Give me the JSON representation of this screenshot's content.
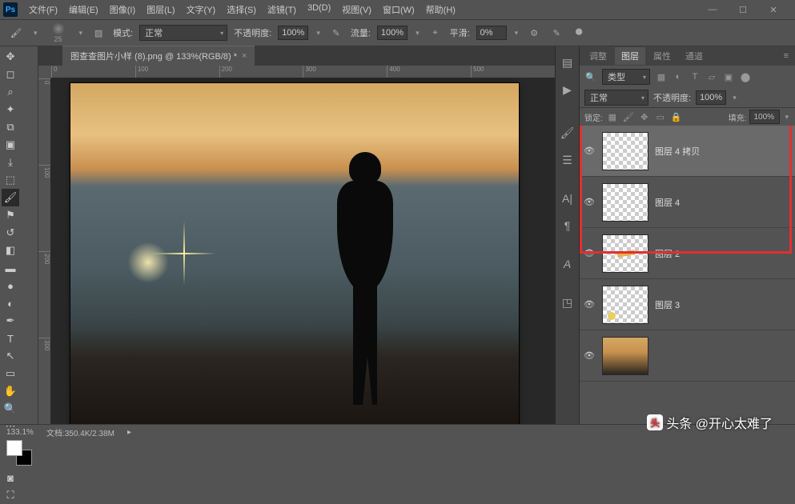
{
  "app": {
    "logo": "Ps"
  },
  "menu": [
    "文件(F)",
    "编辑(E)",
    "图像(I)",
    "图层(L)",
    "文字(Y)",
    "选择(S)",
    "滤镜(T)",
    "3D(D)",
    "视图(V)",
    "窗口(W)",
    "帮助(H)"
  ],
  "optbar": {
    "brush_size": "25",
    "mode_label": "模式:",
    "mode_value": "正常",
    "opacity_label": "不透明度:",
    "opacity_value": "100%",
    "flow_label": "流量:",
    "flow_value": "100%",
    "smooth_label": "平滑:",
    "smooth_value": "0%"
  },
  "document": {
    "tab_title": "图查查图片小样 (8).png @ 133%(RGB/8) *",
    "ruler_h": [
      "0",
      "100",
      "200",
      "300",
      "400",
      "500"
    ],
    "ruler_v": [
      "0",
      "100",
      "200",
      "300"
    ]
  },
  "panel_tabs": {
    "adjust": "调整",
    "layers": "图层",
    "props": "属性",
    "channels": "通道"
  },
  "layer_panel": {
    "filter_label": "类型",
    "blend_mode": "正常",
    "opacity_label": "不透明度:",
    "opacity_value": "100%",
    "lock_label": "锁定:",
    "fill_label": "填充:",
    "fill_value": "100%",
    "layers": [
      {
        "name": "图层 4 拷贝",
        "visible": true,
        "selected": true,
        "thumb": "checker"
      },
      {
        "name": "图层 4",
        "visible": true,
        "selected": false,
        "thumb": "checker"
      },
      {
        "name": "图层 2",
        "visible": true,
        "selected": false,
        "thumb": "smear"
      },
      {
        "name": "图层 3",
        "visible": true,
        "selected": false,
        "thumb": "dot"
      },
      {
        "name": "",
        "visible": true,
        "selected": false,
        "thumb": "photo"
      }
    ]
  },
  "status": {
    "zoom": "133.1%",
    "doc_label": "文档:",
    "doc_size": "350.4K/2.38M"
  },
  "watermark": {
    "logo": "头",
    "text": "头条 @开心太难了"
  }
}
